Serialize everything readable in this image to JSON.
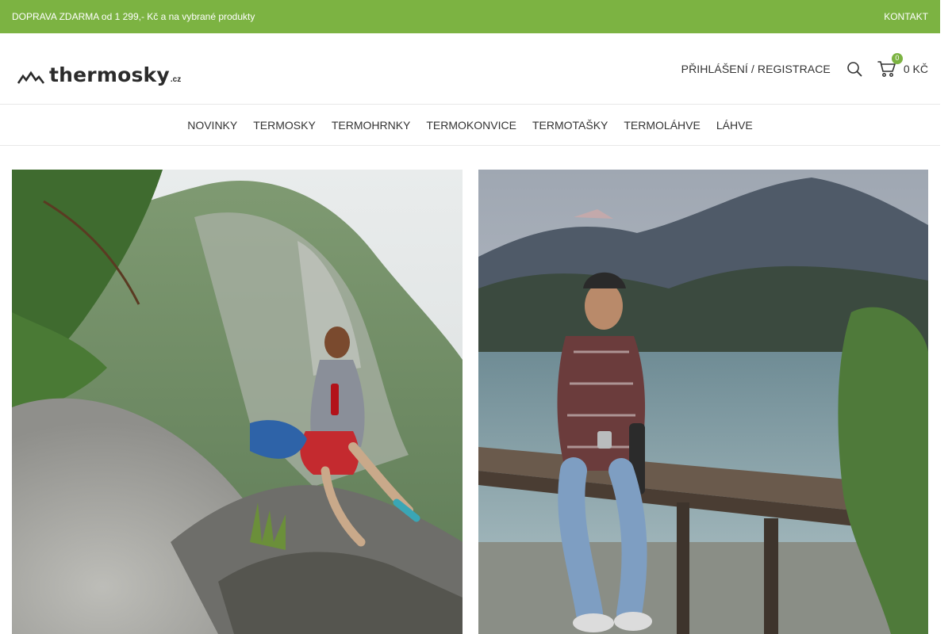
{
  "topbar": {
    "promo": "DOPRAVA ZDARMA od 1 299,- Kč a na vybrané produkty",
    "contact": "KONTAKT",
    "background": "#7cb342"
  },
  "header": {
    "logo_text": "thermosky",
    "logo_tld": ".cz",
    "login_label": "PŘIHLÁŠENÍ / REGISTRACE",
    "search_icon": "search-icon",
    "cart_icon": "shopping-cart-icon",
    "cart_count": "0",
    "cart_total": "0 KČ"
  },
  "nav": {
    "items": [
      {
        "label": "NOVINKY"
      },
      {
        "label": "TERMOSKY"
      },
      {
        "label": "TERMOHRNKY"
      },
      {
        "label": "TERMOKONVICE"
      },
      {
        "label": "TERMOTAŠKY"
      },
      {
        "label": "TERMOLÁHVE"
      },
      {
        "label": "LÁHVE"
      }
    ]
  },
  "banners": {
    "left_image": "woman-sitting-on-rock-with-thermos",
    "right_image": "man-sitting-on-pier-with-thermos"
  },
  "colors": {
    "accent": "#7cb342",
    "text": "#333333",
    "border": "#e8e8e8"
  }
}
